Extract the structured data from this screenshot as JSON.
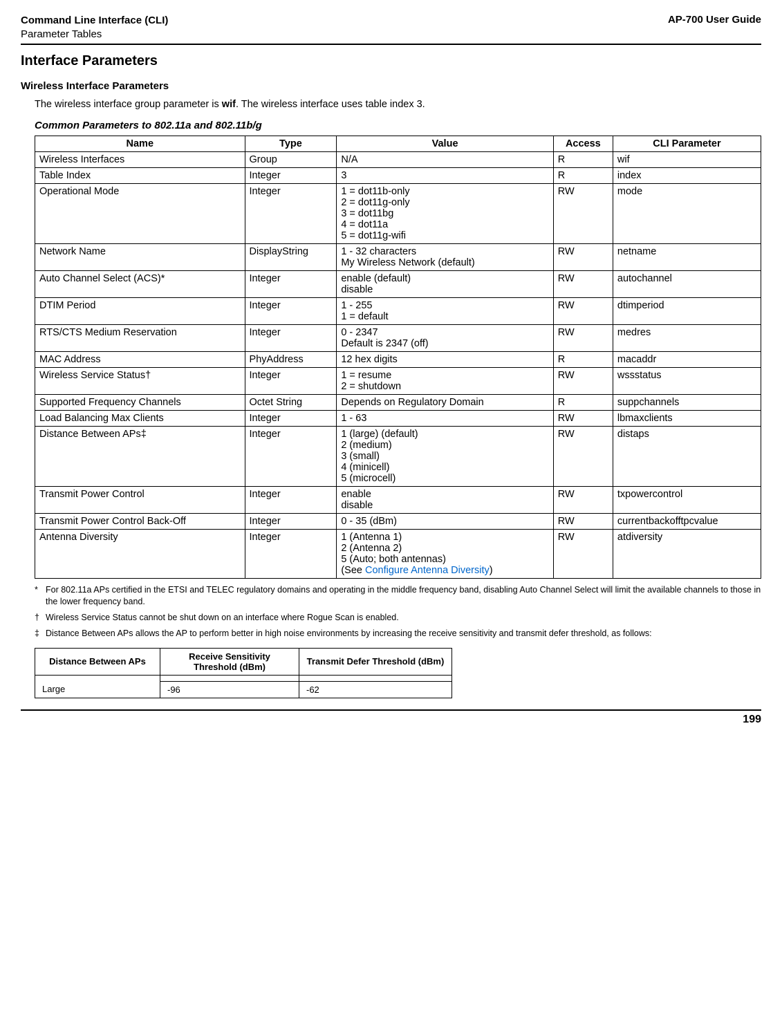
{
  "header": {
    "title": "Command Line Interface (CLI)",
    "subtitle": "Parameter Tables",
    "guide": "AP-700 User Guide"
  },
  "section_title": "Interface Parameters",
  "sub_title": "Wireless Interface Parameters",
  "intro_parts": {
    "a": "The wireless interface group parameter is ",
    "b": "wif",
    "c": ". The wireless interface uses table index 3."
  },
  "table_caption": "Common Parameters to 802.11a and 802.11b/g",
  "columns": {
    "name": "Name",
    "type": "Type",
    "value": "Value",
    "access": "Access",
    "cli": "CLI Parameter"
  },
  "rows": [
    {
      "name": "Wireless Interfaces",
      "type": "Group",
      "value": "N/A",
      "access": "R",
      "cli": "wif"
    },
    {
      "name": "Table Index",
      "type": "Integer",
      "value": "3",
      "access": "R",
      "cli": "index"
    },
    {
      "name": "Operational Mode",
      "type": "Integer",
      "value": "1 = dot11b-only\n2 = dot11g-only\n3 = dot11bg\n4 = dot11a\n5 = dot11g-wifi",
      "access": "RW",
      "cli": "mode"
    },
    {
      "name": "Network Name",
      "type": "DisplayString",
      "value": "1 - 32 characters\nMy Wireless Network (default)",
      "access": "RW",
      "cli": "netname"
    },
    {
      "name": "Auto Channel Select (ACS)*",
      "type": "Integer",
      "value": "enable (default)\ndisable",
      "access": "RW",
      "cli": "autochannel"
    },
    {
      "name": "DTIM Period",
      "type": "Integer",
      "value": "1 - 255\n1 = default",
      "access": "RW",
      "cli": "dtimperiod"
    },
    {
      "name": "RTS/CTS Medium Reservation",
      "type": "Integer",
      "value": "0 - 2347\nDefault is 2347 (off)",
      "access": "RW",
      "cli": "medres"
    },
    {
      "name": "MAC Address",
      "type": "PhyAddress",
      "value": "12 hex digits",
      "access": "R",
      "cli": "macaddr"
    },
    {
      "name": "Wireless Service Status†",
      "type": "Integer",
      "value": "1 = resume\n2 = shutdown",
      "access": "RW",
      "cli": "wssstatus"
    },
    {
      "name": "Supported Frequency Channels",
      "type": "Octet String",
      "value": "Depends on Regulatory Domain",
      "access": "R",
      "cli": "suppchannels"
    },
    {
      "name": "Load Balancing Max Clients",
      "type": "Integer",
      "value": "1 - 63",
      "access": "RW",
      "cli": "lbmaxclients"
    },
    {
      "name": "Distance Between APs‡",
      "type": "Integer",
      "value": "1 (large) (default)\n2 (medium)\n3 (small)\n4 (minicell)\n5 (microcell)",
      "access": "RW",
      "cli": "distaps"
    },
    {
      "name": "Transmit Power Control",
      "type": "Integer",
      "value": "enable\ndisable",
      "access": "RW",
      "cli": "txpowercontrol"
    },
    {
      "name": "Transmit Power Control Back-Off",
      "type": "Integer",
      "value": "0 - 35 (dBm)",
      "access": "RW",
      "cli": "currentbackofftpcvalue"
    },
    {
      "name": "Antenna Diversity",
      "type": "Integer",
      "value": "1 (Antenna 1)\n2 (Antenna 2)\n5 (Auto; both antennas)\n",
      "access": "RW",
      "cli": "atdiversity",
      "link_text": "Configure Antenna Diversity",
      "link_prefix": "(See ",
      "link_suffix": ")"
    }
  ],
  "footnotes": {
    "star": "For 802.11a APs certified in the ETSI and TELEC regulatory domains and operating in the middle frequency band, disabling Auto Channel Select will limit the available channels to those in the lower frequency band.",
    "dagger": "Wireless Service Status cannot be shut down on an interface where Rogue Scan is enabled.",
    "ddagger": "Distance Between APs allows the AP to perform better in high noise environments by increasing the receive sensitivity and transmit defer threshold, as follows:"
  },
  "small_table": {
    "headers": {
      "dist": "Distance Between APs",
      "recv": "Receive Sensitivity Threshold (dBm)",
      "trans": "Transmit Defer Threshold (dBm)"
    },
    "blank_row": {
      "dist": "",
      "recv": "",
      "trans": ""
    },
    "row": {
      "dist": "Large",
      "recv": "-96",
      "trans": "-62"
    }
  },
  "page_number": "199",
  "marks": {
    "star": "*",
    "dagger": "†",
    "ddagger": "‡"
  }
}
